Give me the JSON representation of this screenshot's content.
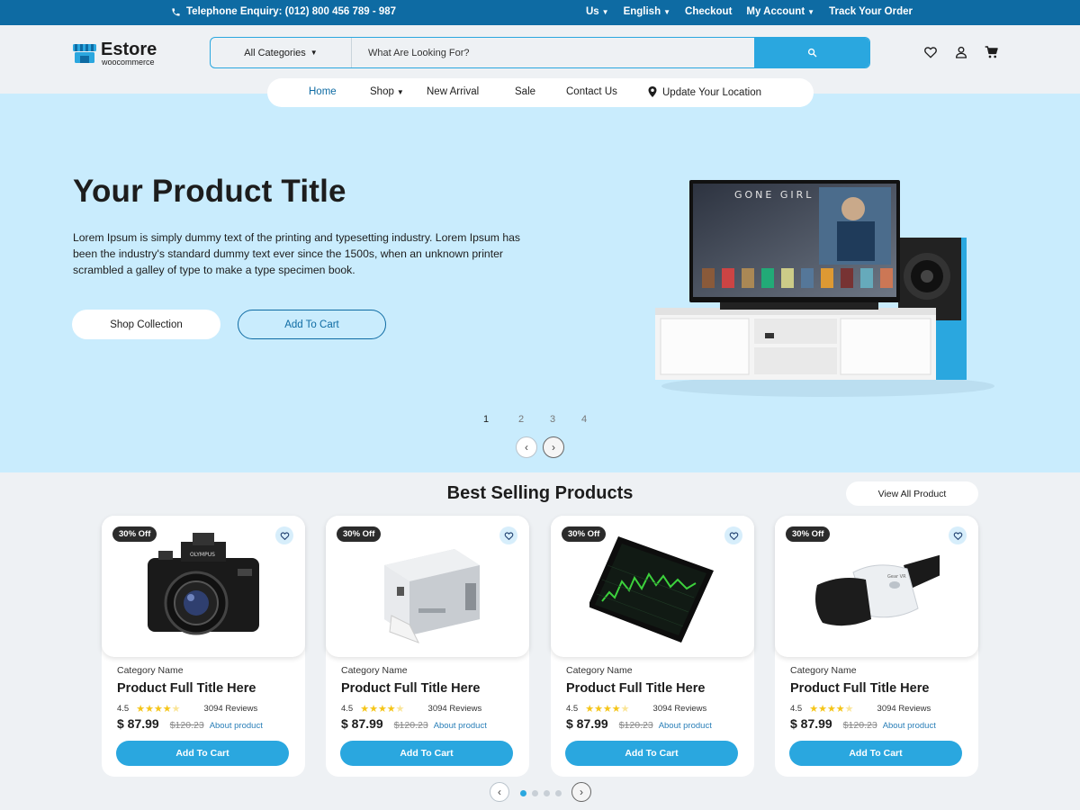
{
  "topbar": {
    "phone_text": "Telephone Enquiry: (012) 800 456 789 - 987",
    "menu": [
      {
        "label": "Us",
        "dropdown": true
      },
      {
        "label": "English",
        "dropdown": true
      },
      {
        "label": "Checkout",
        "dropdown": false
      },
      {
        "label": "My Account",
        "dropdown": true
      },
      {
        "label": "Track Your Order",
        "dropdown": false
      }
    ]
  },
  "header": {
    "logo_name": "Estore",
    "logo_sub": "woocommerce",
    "category_select": "All Categories",
    "search_placeholder": "What Are Looking For?",
    "icons": [
      "heart-icon",
      "user-icon",
      "cart-icon"
    ]
  },
  "nav": {
    "items": [
      {
        "label": "Home",
        "active": true
      },
      {
        "label": "Shop",
        "dropdown": true
      },
      {
        "label": "New Arrival"
      },
      {
        "label": "Sale"
      },
      {
        "label": "Contact Us"
      },
      {
        "label": "Update Your Location",
        "icon": "location-pin-icon"
      }
    ]
  },
  "hero": {
    "title": "Your Product Title",
    "description": "Lorem Ipsum is simply dummy text of the printing and typesetting industry. Lorem Ipsum has been the industry's standard dummy text ever since the 1500s, when an unknown printer scrambled a galley of  type to make a type specimen book.",
    "btn_shop": "Shop Collection",
    "btn_cart": "Add To Cart",
    "tv_title": "GONE GIRL",
    "pages": [
      "1",
      "2",
      "3",
      "4"
    ],
    "current_page": "1"
  },
  "best_selling": {
    "title": "Best Selling Products",
    "view_all": "View All Product",
    "products": [
      {
        "badge": "30% Off",
        "category": "Category Name",
        "title": "Product Full Title Here",
        "rating": "4.5",
        "reviews": "3094 Reviews",
        "price": "$ 87.99",
        "old_price": "$120.23",
        "about": "About product",
        "cta": "Add To Cart",
        "image": "camera"
      },
      {
        "badge": "30% Off",
        "category": "Category Name",
        "title": "Product Full Title Here",
        "rating": "4.5",
        "reviews": "3094 Reviews",
        "price": "$ 87.99",
        "old_price": "$120.23",
        "about": "About product",
        "cta": "Add To Cart",
        "image": "printer"
      },
      {
        "badge": "30% Off",
        "category": "Category Name",
        "title": "Product Full Title Here",
        "rating": "4.5",
        "reviews": "3094 Reviews",
        "price": "$ 87.99",
        "old_price": "$120.23",
        "about": "About product",
        "cta": "Add To Cart",
        "image": "tablet"
      },
      {
        "badge": "30% Off",
        "category": "Category Name",
        "title": "Product Full Title Here",
        "rating": "4.5",
        "reviews": "3094 Reviews",
        "price": "$ 87.99",
        "old_price": "$120.23",
        "about": "About product",
        "cta": "Add To Cart",
        "image": "vr-headset"
      }
    ],
    "carousel_dots": 4,
    "active_dot": 1
  },
  "colors": {
    "topbar": "#0e6ba3",
    "accent": "#2aa7df",
    "hero_bg": "#c9ecfd",
    "page_bg": "#eef1f4"
  }
}
